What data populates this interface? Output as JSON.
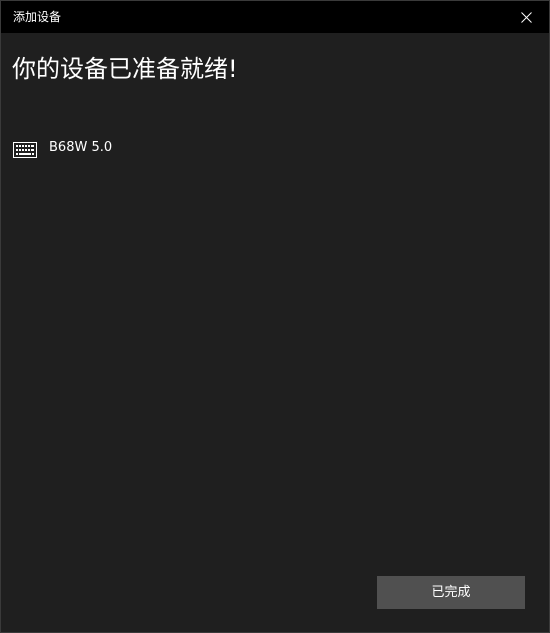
{
  "window": {
    "title": "添加设备"
  },
  "main": {
    "heading": "你的设备已准备就绪!",
    "devices": [
      {
        "name": "B68W 5.0",
        "icon": "keyboard-icon"
      }
    ]
  },
  "footer": {
    "done_label": "已完成"
  },
  "colors": {
    "titlebar": "#000000",
    "background": "#1f1f1f",
    "button": "#505050",
    "text": "#ffffff"
  }
}
